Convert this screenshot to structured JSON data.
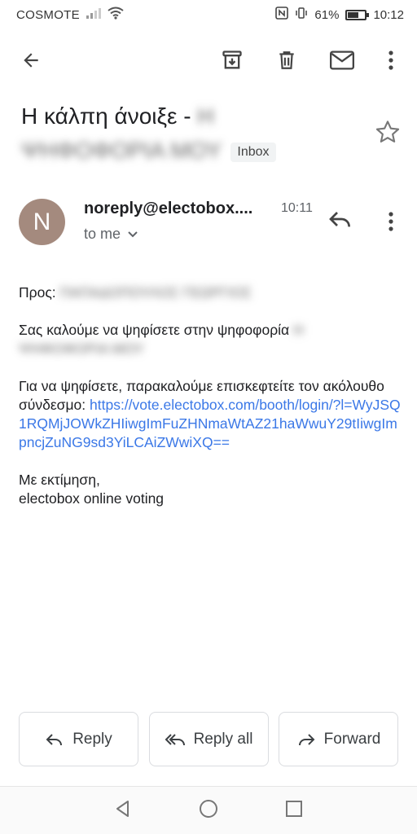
{
  "status_bar": {
    "carrier": "COSMOTE",
    "battery_percent": "61%",
    "battery_level": 0.61,
    "time": "10:12"
  },
  "email": {
    "subject_visible": "Η κάλπη άνοιξε -",
    "subject_blurred_1": "Η",
    "subject_blurred_2": "ΨΗΦΟΦΟΡΙΑ ΜΟΥ",
    "label": "Inbox",
    "avatar_letter": "N",
    "sender": "noreply@electobox....",
    "time": "10:11",
    "recipient": "to me"
  },
  "body": {
    "greeting_label": "Προς:",
    "greeting_blurred": "ΠΑΠΑΔΟΠΟΥΛΟΣ ΓΕΩΡΓΙΟΣ",
    "invite_text": "Σας καλούμε να ψηφίσετε στην ψηφοφορία",
    "invite_blurred_1": "Η",
    "invite_blurred_2": "ΨΗΦΟΦΟΡΙΑ ΜΟΥ",
    "instruction": "Για να ψηφίσετε, παρακαλούμε επισκεφτείτε τον ακόλουθο σύνδεσμο:",
    "link": "https://vote.electobox.com/booth/login/?l=WyJSQ1RQMjJOWkZHIiwgImFuZHNmaWtAZ21haWwuY29tIiwgImpncjZuNG9sd3YiLCAiZWwiXQ==",
    "sign_off": "Με εκτίμηση,",
    "signature": "electobox online voting"
  },
  "actions": {
    "reply": "Reply",
    "reply_all": "Reply all",
    "forward": "Forward"
  },
  "colors": {
    "avatar": "#a48a7e",
    "link": "#3b78e7"
  }
}
